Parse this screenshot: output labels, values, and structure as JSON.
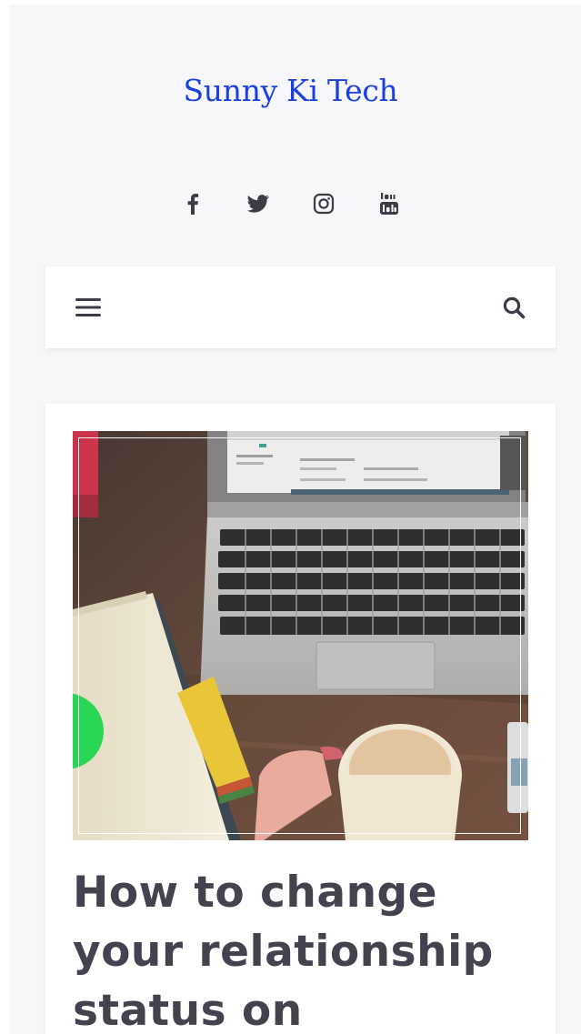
{
  "site": {
    "title": "Sunny Ki Tech",
    "title_color": "#1a3fe0"
  },
  "social": [
    {
      "name": "facebook-icon"
    },
    {
      "name": "twitter-icon"
    },
    {
      "name": "instagram-icon"
    },
    {
      "name": "youtube-icon"
    }
  ],
  "navbar": {
    "menu_icon": "hamburger-menu-icon",
    "search_icon": "search-icon"
  },
  "post": {
    "title": "How to change your relationship status on",
    "title_color": "#43424f",
    "image_subject": "laptop-coffee-desk-photo"
  },
  "colors": {
    "page_background": "#f7f7fb",
    "card_background": "#ffffff",
    "icon_color": "#3c3b48"
  }
}
